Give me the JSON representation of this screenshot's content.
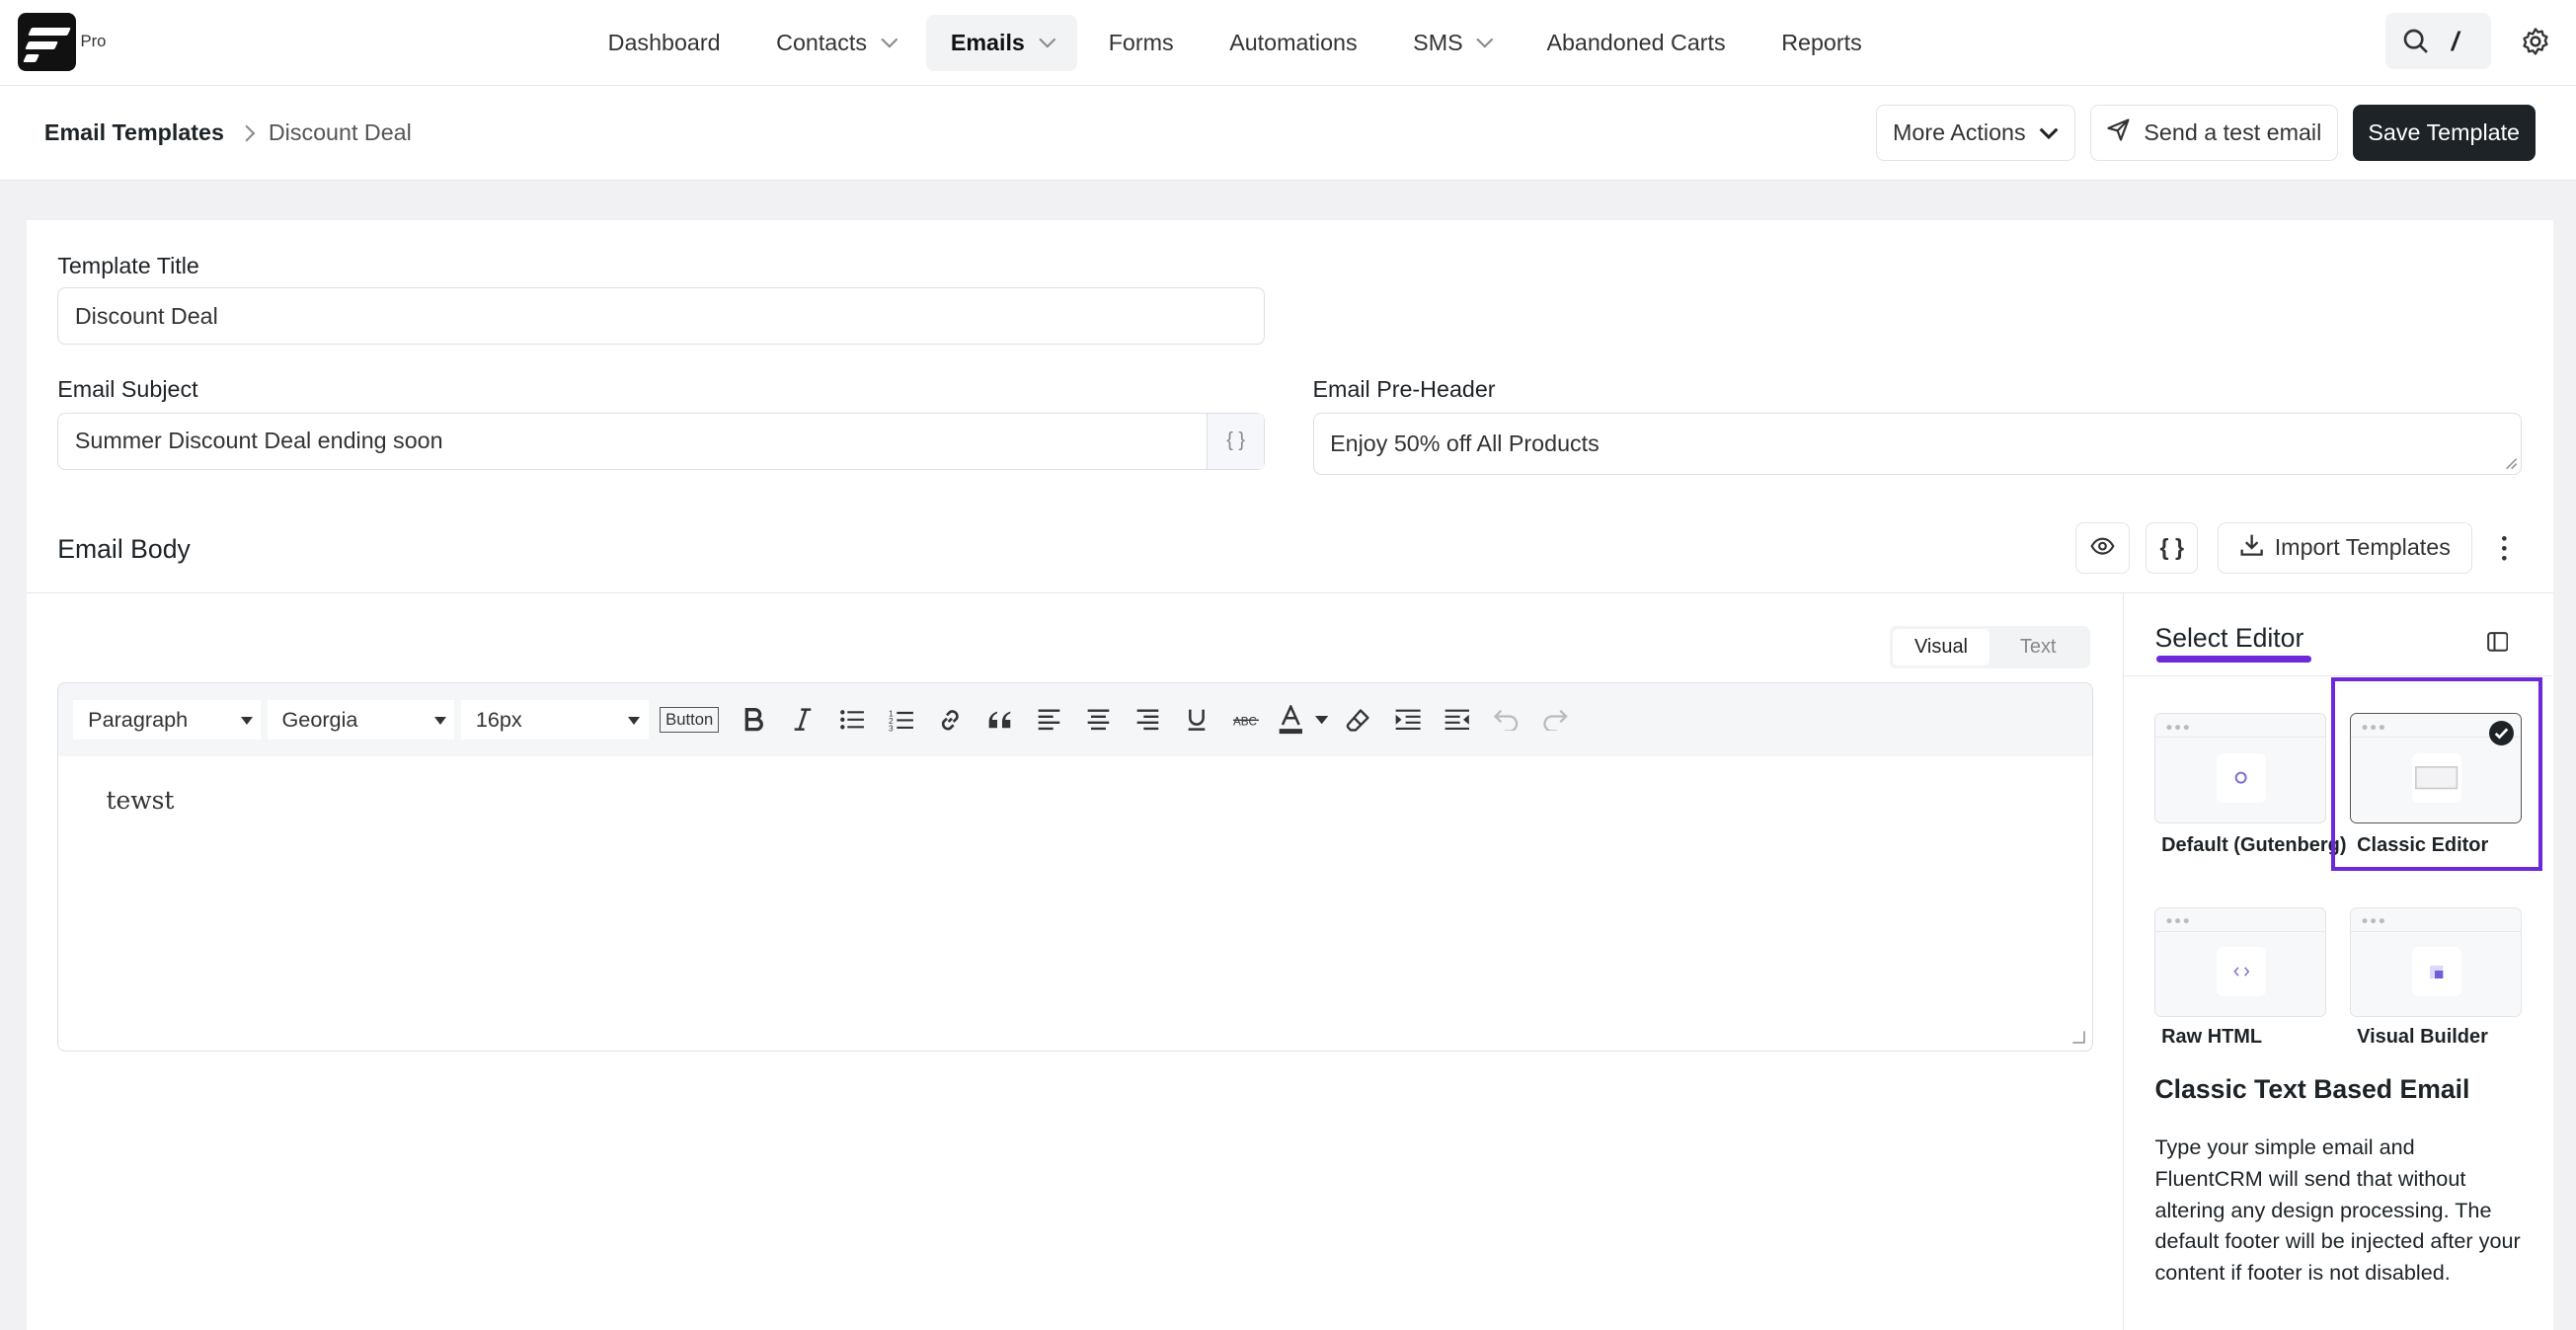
{
  "brand": {
    "badge": "Pro"
  },
  "nav": {
    "items": [
      {
        "label": "Dashboard"
      },
      {
        "label": "Contacts"
      },
      {
        "label": "Emails"
      },
      {
        "label": "Forms"
      },
      {
        "label": "Automations"
      },
      {
        "label": "SMS"
      },
      {
        "label": "Abandoned Carts"
      },
      {
        "label": "Reports"
      }
    ],
    "active": "Emails"
  },
  "breadcrumb": {
    "root": "Email Templates",
    "current": "Discount Deal"
  },
  "actions": {
    "more": "More Actions",
    "test": "Send a test email",
    "save": "Save Template"
  },
  "form": {
    "title_label": "Template Title",
    "title_value": "Discount Deal",
    "subject_label": "Email Subject",
    "subject_value": "Summer Discount Deal ending soon",
    "merge_tag": "{ }",
    "preheader_label": "Email Pre-Header",
    "preheader_value": "Enjoy 50% off All Products"
  },
  "body": {
    "title": "Email Body",
    "import": "Import Templates",
    "code_btn": "{ }"
  },
  "editor": {
    "tabs": [
      "Visual",
      "Text"
    ],
    "active_tab": "Visual",
    "format": "Paragraph",
    "font": "Georgia",
    "size": "16px",
    "button_tag": "Button",
    "content": "tewst"
  },
  "select_editor": {
    "title": "Select Editor",
    "accent": "#6d28d9",
    "options": [
      {
        "label": "Default (Gutenberg)"
      },
      {
        "label": "Classic Editor"
      },
      {
        "label": "Raw HTML"
      },
      {
        "label": "Visual Builder"
      }
    ],
    "selected": "Classic Editor",
    "desc_title": "Classic Text Based Email",
    "desc": "Type your simple email and FluentCRM will send that without altering any design processing. The default footer will be injected after your content if footer is not disabled."
  }
}
